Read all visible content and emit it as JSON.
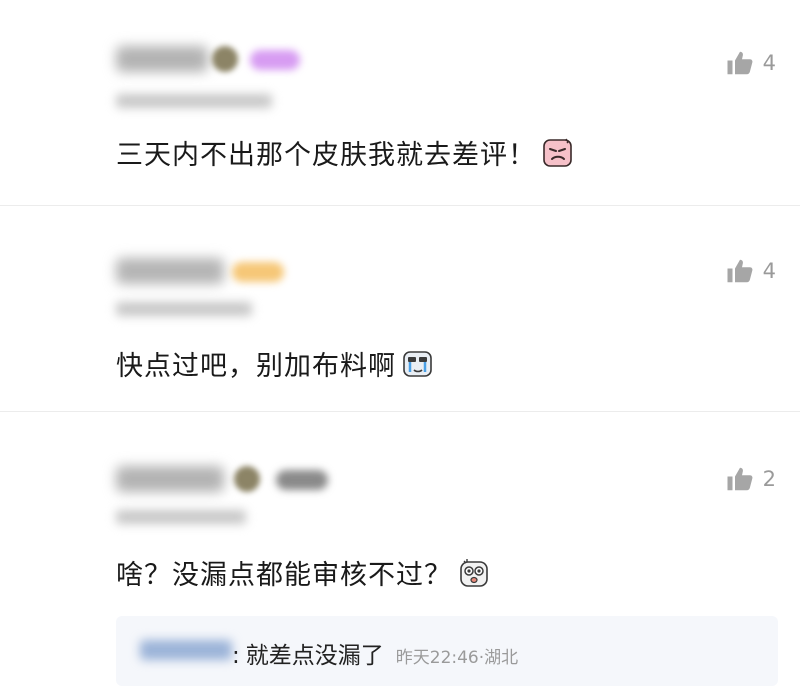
{
  "comments": [
    {
      "likes": "4",
      "text": "三天内不出那个皮肤我就去差评！"
    },
    {
      "likes": "4",
      "text": "快点过吧，别加布料啊"
    },
    {
      "likes": "2",
      "text": "啥？没漏点都能审核不过？",
      "reply": {
        "separator": ":",
        "text": "就差点没漏了",
        "time_location": "昨天22:46·湖北"
      }
    }
  ],
  "colors": {
    "text": "#1a1a1a",
    "muted": "#9a9a9a",
    "reply_bg": "#f5f7fb"
  },
  "icons": {
    "like": "thumbs-up-icon",
    "emoji1": "angry-emoji-icon",
    "emoji2": "crying-emoji-icon",
    "emoji3": "surprised-emoji-icon"
  }
}
